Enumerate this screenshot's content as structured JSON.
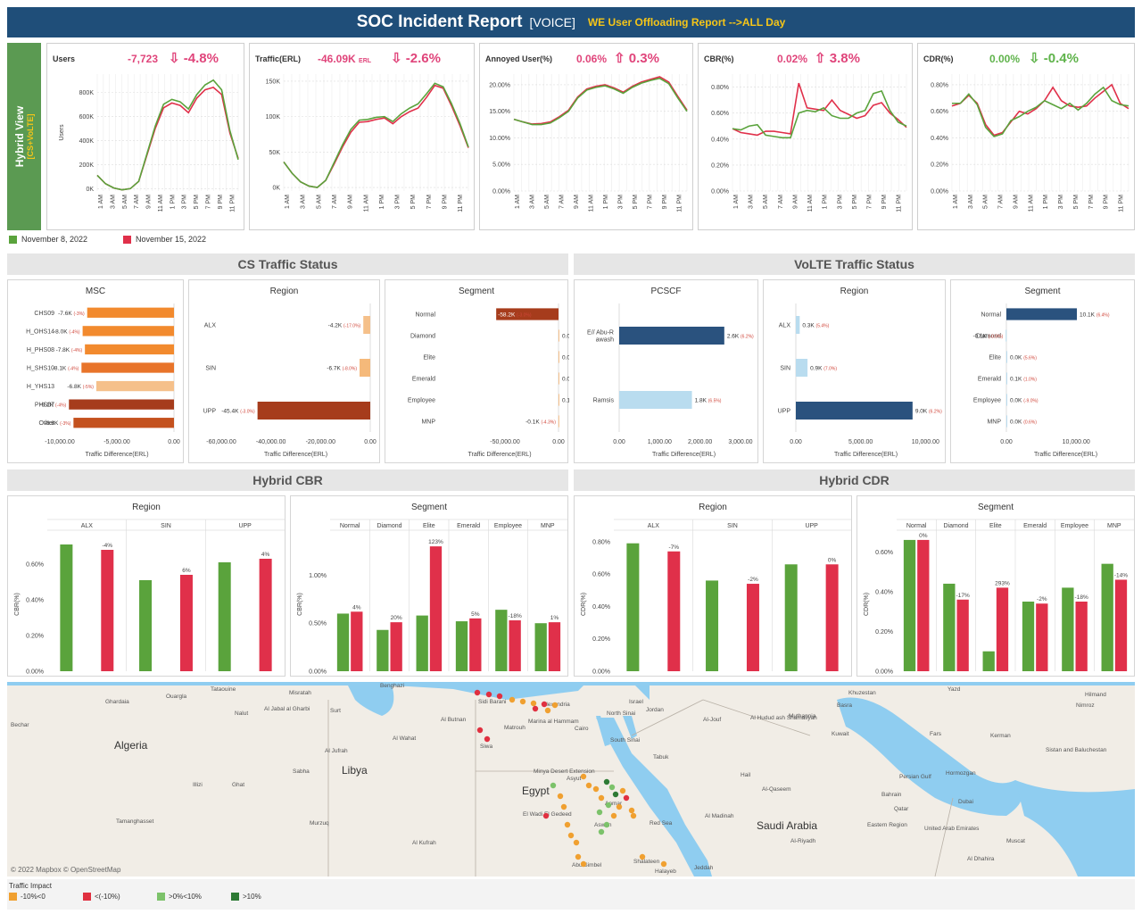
{
  "header": {
    "title": "SOC Incident Report",
    "subtitle": "[VOICE]",
    "report_name": "WE User Offloading Report -->ALL Day",
    "bg_color": "#1f4e79",
    "accent": "#f5c518"
  },
  "hybrid_view": {
    "label": "Hybrid View",
    "sub": "[CS+VoLTE]"
  },
  "colors": {
    "green": "#5aa33c",
    "red": "#e0304a",
    "delta_up": "#e0457b",
    "delta_good": "#5fb34b"
  },
  "hours": [
    "1 AM",
    "3 AM",
    "5 AM",
    "7 AM",
    "9 AM",
    "11 AM",
    "1 PM",
    "3 PM",
    "5 PM",
    "7 PM",
    "9 PM",
    "11 PM"
  ],
  "legend": {
    "green": "November 8, 2022",
    "red": "November 15, 2022"
  },
  "kpis": [
    {
      "title": "Users",
      "value": "-7,723",
      "unit": "",
      "arrow": "⇩",
      "delta": "-4.8%",
      "delta_color": "#e0457b",
      "value_color": "#e0457b",
      "ylabel": "Users",
      "y_ticks": [
        "0K",
        "200K",
        "400K",
        "600K",
        "800K"
      ],
      "y_tick_values": [
        0,
        200,
        400,
        600,
        800
      ],
      "ylim": [
        -20,
        950
      ],
      "green": [
        110,
        40,
        5,
        -10,
        0,
        60,
        290,
        520,
        700,
        740,
        720,
        660,
        780,
        860,
        900,
        820,
        480,
        240
      ],
      "red": [
        110,
        40,
        5,
        -10,
        0,
        60,
        280,
        500,
        670,
        710,
        690,
        630,
        750,
        820,
        840,
        780,
        460,
        250
      ]
    },
    {
      "title": "Traffic(ERL)",
      "value": "-46.09K",
      "unit": "ERL",
      "arrow": "⇩",
      "delta": "-2.6%",
      "delta_color": "#e0457b",
      "value_color": "#e0457b",
      "ylabel": "",
      "y_ticks": [
        "0K",
        "50K",
        "100K",
        "150K"
      ],
      "y_tick_values": [
        0,
        50,
        100,
        150
      ],
      "ylim": [
        -5,
        160
      ],
      "green": [
        36,
        20,
        8,
        2,
        0,
        10,
        35,
        60,
        82,
        95,
        96,
        99,
        100,
        93,
        104,
        112,
        118,
        132,
        147,
        142,
        118,
        90,
        57
      ],
      "red": [
        36,
        20,
        8,
        2,
        0,
        10,
        33,
        57,
        78,
        92,
        93,
        96,
        98,
        90,
        100,
        107,
        112,
        127,
        144,
        140,
        115,
        87,
        56
      ]
    },
    {
      "title": "Annoyed User(%)",
      "value": "0.06%",
      "unit": "",
      "arrow": "⇧",
      "delta": "0.3%",
      "delta_color": "#e0457b",
      "value_color": "#e0457b",
      "ylabel": "",
      "y_ticks": [
        "0.00%",
        "5.00%",
        "10.00%",
        "15.00%",
        "20.00%"
      ],
      "y_tick_values": [
        0,
        5,
        10,
        15,
        20
      ],
      "ylim": [
        0,
        22
      ],
      "green": [
        13.5,
        13.0,
        12.5,
        12.5,
        12.8,
        13.8,
        15.0,
        17.5,
        19.0,
        19.5,
        19.8,
        19.2,
        18.4,
        19.5,
        20.3,
        20.8,
        21.2,
        20.2,
        17.5,
        15.0
      ],
      "red": [
        13.5,
        13.0,
        12.6,
        12.7,
        13.0,
        14.0,
        15.2,
        17.7,
        19.2,
        19.7,
        20.0,
        19.4,
        18.6,
        19.7,
        20.5,
        21.0,
        21.5,
        20.5,
        17.8,
        15.2
      ]
    },
    {
      "title": "CBR(%)",
      "value": "0.02%",
      "unit": "",
      "arrow": "⇧",
      "delta": "3.8%",
      "delta_color": "#e0457b",
      "value_color": "#e0457b",
      "ylabel": "",
      "y_ticks": [
        "0.00%",
        "0.20%",
        "0.40%",
        "0.60%",
        "0.80%"
      ],
      "y_tick_values": [
        0,
        0.2,
        0.4,
        0.6,
        0.8
      ],
      "ylim": [
        0,
        0.9
      ],
      "green": [
        0.48,
        0.47,
        0.5,
        0.51,
        0.43,
        0.42,
        0.41,
        0.41,
        0.6,
        0.62,
        0.61,
        0.64,
        0.58,
        0.56,
        0.56,
        0.6,
        0.62,
        0.75,
        0.77,
        0.62,
        0.53,
        0.5
      ],
      "red": [
        0.48,
        0.45,
        0.44,
        0.43,
        0.46,
        0.46,
        0.45,
        0.44,
        0.83,
        0.64,
        0.63,
        0.62,
        0.7,
        0.62,
        0.59,
        0.56,
        0.58,
        0.66,
        0.68,
        0.6,
        0.55,
        0.49
      ]
    },
    {
      "title": "CDR(%)",
      "value": "0.00%",
      "unit": "",
      "arrow": "⇩",
      "delta": "-0.4%",
      "delta_color": "#5fb34b",
      "value_color": "#5fb34b",
      "ylabel": "",
      "y_ticks": [
        "0.00%",
        "0.20%",
        "0.40%",
        "0.60%",
        "0.80%"
      ],
      "y_tick_values": [
        0,
        0.2,
        0.4,
        0.6,
        0.8
      ],
      "ylim": [
        0,
        0.88
      ],
      "green": [
        0.66,
        0.66,
        0.73,
        0.65,
        0.48,
        0.41,
        0.43,
        0.53,
        0.56,
        0.6,
        0.63,
        0.68,
        0.65,
        0.62,
        0.66,
        0.61,
        0.66,
        0.73,
        0.78,
        0.68,
        0.65,
        0.64
      ],
      "red": [
        0.64,
        0.66,
        0.72,
        0.66,
        0.5,
        0.42,
        0.44,
        0.52,
        0.6,
        0.58,
        0.62,
        0.68,
        0.78,
        0.68,
        0.64,
        0.63,
        0.64,
        0.7,
        0.75,
        0.8,
        0.66,
        0.62
      ]
    }
  ],
  "sections": {
    "cs": "CS Traffic Status",
    "volte": "VoLTE Traffic Status",
    "cbr": "Hybrid CBR",
    "cdr": "Hybrid CDR"
  },
  "axis_traffic": "Traffic Difference(ERL)",
  "cs_msc": {
    "title": "MSC",
    "ticks": [
      "-10,000.00",
      "-5,000.00",
      "0.00"
    ],
    "tick_values": [
      -10000,
      -5000,
      0
    ],
    "xlim": [
      -10000,
      0
    ],
    "rows": [
      {
        "name": "CHS09",
        "label": "-7.6K",
        "pct": "(-3%)",
        "value": -7600,
        "color": "#f28a2e"
      },
      {
        "name": "H_OHS14",
        "label": "-8.0K",
        "pct": "(-4%)",
        "value": -8000,
        "color": "#f28a2e"
      },
      {
        "name": "H_PHS08",
        "label": "-7.8K",
        "pct": "(-4%)",
        "value": -7800,
        "color": "#f28a2e"
      },
      {
        "name": "H_SHS10",
        "label": "-8.1K",
        "pct": "(-4%)",
        "value": -8100,
        "color": "#e8742a"
      },
      {
        "name": "H_YHS13",
        "label": "-6.8K",
        "pct": "(-5%)",
        "value": -6800,
        "color": "#f5c08a"
      },
      {
        "name": "PHS07",
        "label": "-9.2K",
        "pct": "(-4%)",
        "value": -9200,
        "color": "#a63c1c"
      },
      {
        "name": "Other",
        "label": "-8.8K",
        "pct": "(-3%)",
        "value": -8800,
        "color": "#c4511e"
      }
    ]
  },
  "cs_region": {
    "title": "Region",
    "ticks": [
      "-60,000.00",
      "-40,000.00",
      "-20,000.00",
      "0.00"
    ],
    "tick_values": [
      -60000,
      -40000,
      -20000,
      0
    ],
    "xlim": [
      -60000,
      0
    ],
    "rows": [
      {
        "name": "ALX",
        "label": "-4.2K",
        "pct": "(-17.0%)",
        "value": -2800,
        "color": "#f5c08a"
      },
      {
        "name": "SIN",
        "label": "-6.7K",
        "pct": "(-8.0%)",
        "value": -4300,
        "color": "#f5b97a"
      },
      {
        "name": "UPP",
        "label": "-45.4K",
        "pct": "(-3.0%)",
        "value": -45400,
        "color": "#a63c1c"
      }
    ]
  },
  "cs_segment": {
    "title": "Segment",
    "ticks": [
      "-50,000.00",
      "0.00"
    ],
    "tick_values": [
      -50000,
      0
    ],
    "xlim": [
      -110000,
      0
    ],
    "rows": [
      {
        "name": "Normal",
        "label": "-58.2K",
        "pct": "(-3.0%)",
        "value": -58200,
        "color": "#a63c1c",
        "inside": true
      },
      {
        "name": "Diamond",
        "label": "0.0K",
        "pct": "(-5.7%)",
        "value": 0,
        "color": "#f5c08a"
      },
      {
        "name": "Elite",
        "label": "0.0K",
        "pct": "(-24.4%)",
        "value": 0,
        "color": "#f5c08a"
      },
      {
        "name": "Emerald",
        "label": "0.0K",
        "pct": "(-0.3%)",
        "value": 0,
        "color": "#f5c08a"
      },
      {
        "name": "Employee",
        "label": "0.1K",
        "pct": "(23.7%)",
        "value": 100,
        "color": "#f5c08a"
      },
      {
        "name": "MNP",
        "label": "-0.1K",
        "pct": "(-4.3%)",
        "value": -100,
        "color": "#f5c08a"
      }
    ]
  },
  "volte_pcscf": {
    "title": "PCSCF",
    "ticks": [
      "0.00",
      "1,000.00",
      "2,000.00",
      "3,000.00"
    ],
    "tick_values": [
      0,
      1000,
      2000,
      3000
    ],
    "xlim": [
      0,
      3200
    ],
    "rows": [
      {
        "name": "E// Abu-Rawash",
        "label": "2.6K",
        "pct": "(6.2%)",
        "value": 2600,
        "color": "#2a527e"
      },
      {
        "name": "Ramsis",
        "label": "1.8K",
        "pct": "(6.5%)",
        "value": 1800,
        "color": "#b9dcef"
      }
    ]
  },
  "volte_region": {
    "title": "Region",
    "ticks": [
      "0.00",
      "5,000.00",
      "10,000.00"
    ],
    "tick_values": [
      0,
      5000,
      10000
    ],
    "xlim": [
      0,
      10800
    ],
    "rows": [
      {
        "name": "ALX",
        "label": "0.3K",
        "pct": "(5.4%)",
        "value": 300,
        "color": "#b9dcef"
      },
      {
        "name": "SIN",
        "label": "0.9K",
        "pct": "(7.0%)",
        "value": 900,
        "color": "#b9dcef"
      },
      {
        "name": "UPP",
        "label": "9.0K",
        "pct": "(6.2%)",
        "value": 9000,
        "color": "#2a527e"
      }
    ]
  },
  "volte_segment": {
    "title": "Segment",
    "ticks": [
      "0.00",
      "10,000.00"
    ],
    "tick_values": [
      0,
      10000
    ],
    "xlim": [
      0,
      17000
    ],
    "rows": [
      {
        "name": "Normal",
        "label": "10.1K",
        "pct": "(6.4%)",
        "value": 10100,
        "color": "#2a527e"
      },
      {
        "name": "Diamond",
        "label": "-0.1K",
        "pct": "(-0.5%)",
        "value": -100,
        "color": "#b9dcef"
      },
      {
        "name": "Elite",
        "label": "0.0K",
        "pct": "(5.6%)",
        "value": 0,
        "color": "#b9dcef"
      },
      {
        "name": "Emerald",
        "label": "0.1K",
        "pct": "(1.0%)",
        "value": 100,
        "color": "#b9dcef"
      },
      {
        "name": "Employee",
        "label": "0.0K",
        "pct": "(-9.0%)",
        "value": 0,
        "color": "#b9dcef"
      },
      {
        "name": "MNP",
        "label": "0.0K",
        "pct": "(0.6%)",
        "value": 0,
        "color": "#b9dcef"
      }
    ]
  },
  "cbr_region": {
    "title": "Region",
    "ylabel": "CBR(%)",
    "ticks": [
      "0.00%",
      "0.20%",
      "0.40%",
      "0.60%"
    ],
    "tick_values": [
      0,
      0.2,
      0.4,
      0.6
    ],
    "ylim": [
      0,
      0.78
    ],
    "groups": [
      {
        "name": "ALX",
        "green": 0.71,
        "red": 0.68,
        "label": "-4%"
      },
      {
        "name": "SIN",
        "green": 0.51,
        "red": 0.54,
        "label": "6%"
      },
      {
        "name": "UPP",
        "green": 0.61,
        "red": 0.63,
        "label": "4%"
      }
    ]
  },
  "cbr_segment": {
    "title": "Segment",
    "ylabel": "CBR(%)",
    "ticks": [
      "0.00%",
      "0.50%",
      "1.00%"
    ],
    "tick_values": [
      0,
      0.5,
      1.0
    ],
    "ylim": [
      0,
      1.45
    ],
    "groups": [
      {
        "name": "Normal",
        "green": 0.6,
        "red": 0.62,
        "label": "4%"
      },
      {
        "name": "Diamond",
        "green": 0.43,
        "red": 0.51,
        "label": "20%"
      },
      {
        "name": "Elite",
        "green": 0.58,
        "red": 1.3,
        "label": "123%"
      },
      {
        "name": "Emerald",
        "green": 0.52,
        "red": 0.55,
        "label": "5%"
      },
      {
        "name": "Employee",
        "green": 0.64,
        "red": 0.53,
        "label": "-18%"
      },
      {
        "name": "MNP",
        "green": 0.5,
        "red": 0.51,
        "label": "1%"
      }
    ]
  },
  "cdr_region": {
    "title": "Region",
    "ylabel": "CDR(%)",
    "ticks": [
      "0.00%",
      "0.20%",
      "0.40%",
      "0.60%",
      "0.80%"
    ],
    "tick_values": [
      0,
      0.2,
      0.4,
      0.6,
      0.8
    ],
    "ylim": [
      0,
      0.86
    ],
    "groups": [
      {
        "name": "ALX",
        "green": 0.79,
        "red": 0.74,
        "label": "-7%"
      },
      {
        "name": "SIN",
        "green": 0.56,
        "red": 0.54,
        "label": "-2%"
      },
      {
        "name": "UPP",
        "green": 0.66,
        "red": 0.66,
        "label": "0%"
      }
    ]
  },
  "cdr_segment": {
    "title": "Segment",
    "ylabel": "CDR(%)",
    "ticks": [
      "0.00%",
      "0.20%",
      "0.40%",
      "0.60%"
    ],
    "tick_values": [
      0,
      0.2,
      0.4,
      0.6
    ],
    "ylim": [
      0,
      0.7
    ],
    "groups": [
      {
        "name": "Normal",
        "green": 0.66,
        "red": 0.66,
        "label": "0%"
      },
      {
        "name": "Diamond",
        "green": 0.44,
        "red": 0.36,
        "label": "-17%"
      },
      {
        "name": "Elite",
        "green": 0.1,
        "red": 0.42,
        "label": "293%"
      },
      {
        "name": "Emerald",
        "green": 0.35,
        "red": 0.34,
        "label": "-2%"
      },
      {
        "name": "Employee",
        "green": 0.42,
        "red": 0.35,
        "label": "-18%"
      },
      {
        "name": "MNP",
        "green": 0.54,
        "red": 0.46,
        "label": "-14%"
      }
    ]
  },
  "map": {
    "credit": "© 2022 Mapbox © OpenStreetMap",
    "labels": [
      {
        "text": "Algeria",
        "big": true
      },
      {
        "text": "Libya",
        "big": true
      },
      {
        "text": "Egypt",
        "big": true
      },
      {
        "text": "Saudi Arabia",
        "big": true
      },
      {
        "text": "Jordan",
        "big": false
      },
      {
        "text": "Benghazi",
        "big": false
      },
      {
        "text": "Tataouine",
        "big": false
      },
      {
        "text": "Misratah",
        "big": false
      },
      {
        "text": "Ouargla",
        "big": false
      },
      {
        "text": "Ghardaia",
        "big": false
      },
      {
        "text": "Bechar",
        "big": false
      },
      {
        "text": "Nalut",
        "big": false
      },
      {
        "text": "Al Jabal al Gharbi",
        "big": false
      },
      {
        "text": "Surt",
        "big": false
      },
      {
        "text": "Al Butnan",
        "big": false
      },
      {
        "text": "Al Wahat",
        "big": false
      },
      {
        "text": "Al Jufrah",
        "big": false
      },
      {
        "text": "Sabha",
        "big": false
      },
      {
        "text": "Illizi",
        "big": false
      },
      {
        "text": "Ghat",
        "big": false
      },
      {
        "text": "Murzuq",
        "big": false
      },
      {
        "text": "Tamanghasset",
        "big": false
      },
      {
        "text": "Al Kufrah",
        "big": false
      },
      {
        "text": "Alexandria",
        "big": false
      },
      {
        "text": "Matrouh",
        "big": false
      },
      {
        "text": "Cairo",
        "big": false
      },
      {
        "text": "North Sinai",
        "big": false
      },
      {
        "text": "South Sinai",
        "big": false
      },
      {
        "text": "Israel",
        "big": false
      },
      {
        "text": "Minya Desert Extension",
        "big": false
      },
      {
        "text": "Asyut",
        "big": false
      },
      {
        "text": "Anmar",
        "big": false
      },
      {
        "text": "El Wadi El Gedeed",
        "big": false
      },
      {
        "text": "Aswan",
        "big": false
      },
      {
        "text": "Abu Simbel",
        "big": false
      },
      {
        "text": "Shalateen",
        "big": false
      },
      {
        "text": "Halayeb",
        "big": false
      },
      {
        "text": "Tabuk",
        "big": false
      },
      {
        "text": "Al-Jouf",
        "big": false
      },
      {
        "text": "Al Hudud ash Shamaliyah",
        "big": false
      },
      {
        "text": "Muthannia",
        "big": false
      },
      {
        "text": "Hail",
        "big": false
      },
      {
        "text": "Al-Qaseem",
        "big": false
      },
      {
        "text": "Al Madinah",
        "big": false
      },
      {
        "text": "Al-Riyadh",
        "big": false
      },
      {
        "text": "Eastern Region",
        "big": false
      },
      {
        "text": "Jeddah",
        "big": false
      },
      {
        "text": "Red Sea",
        "big": false
      },
      {
        "text": "Khuzestan",
        "big": false
      },
      {
        "text": "Yazd",
        "big": false
      },
      {
        "text": "Fars",
        "big": false
      },
      {
        "text": "Kerman",
        "big": false
      },
      {
        "text": "Hormozgan",
        "big": false
      },
      {
        "text": "Basra",
        "big": false
      },
      {
        "text": "Kuwait",
        "big": false
      },
      {
        "text": "Bahrain",
        "big": false
      },
      {
        "text": "Qatar",
        "big": false
      },
      {
        "text": "Dubai",
        "big": false
      },
      {
        "text": "United Arab Emirates",
        "big": false
      },
      {
        "text": "Muscat",
        "big": false
      },
      {
        "text": "Al Dhahira",
        "big": false
      },
      {
        "text": "Hilmand",
        "big": false
      },
      {
        "text": "Nimroz",
        "big": false
      },
      {
        "text": "Sistan and Baluchestan",
        "big": false
      },
      {
        "text": "Persian Gulf",
        "big": false
      },
      {
        "text": "Sidi Barani",
        "big": false
      },
      {
        "text": "Marina al Hammam",
        "big": false
      },
      {
        "text": "Siwa",
        "big": false
      }
    ]
  },
  "traffic_legend": {
    "title": "Traffic Impact",
    "items": [
      {
        "label": "-10%<0",
        "color": "#f0a030"
      },
      {
        "label": "<(-10%)",
        "color": "#e03040"
      },
      {
        "label": ">0%<10%",
        "color": "#7cc26a"
      },
      {
        "label": ">10%",
        "color": "#2d7a34"
      }
    ]
  }
}
